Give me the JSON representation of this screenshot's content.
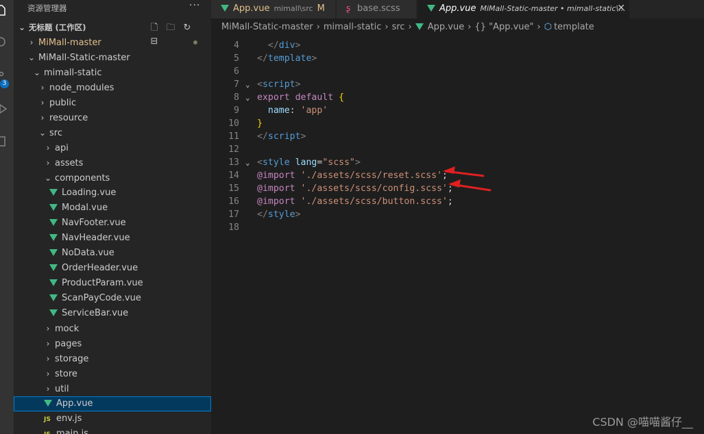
{
  "sidebar": {
    "title": "资源管理器",
    "more": "···",
    "root": "无标题 (工作区)",
    "items": [
      {
        "label": "MiMall-master",
        "kind": "folder-collapsed",
        "depth": 0
      },
      {
        "label": "MiMall-Static-master",
        "kind": "folder-open",
        "depth": 0
      },
      {
        "label": "mimall-static",
        "kind": "folder-open",
        "depth": 1
      },
      {
        "label": "node_modules",
        "kind": "folder-collapsed",
        "depth": 2
      },
      {
        "label": "public",
        "kind": "folder-collapsed",
        "depth": 2
      },
      {
        "label": "resource",
        "kind": "folder-collapsed",
        "depth": 2
      },
      {
        "label": "src",
        "kind": "folder-open",
        "depth": 2
      },
      {
        "label": "api",
        "kind": "folder-collapsed",
        "depth": 3
      },
      {
        "label": "assets",
        "kind": "folder-collapsed",
        "depth": 3
      },
      {
        "label": "components",
        "kind": "folder-open",
        "depth": 3
      },
      {
        "label": "Loading.vue",
        "kind": "vue",
        "depth": 4
      },
      {
        "label": "Modal.vue",
        "kind": "vue",
        "depth": 4
      },
      {
        "label": "NavFooter.vue",
        "kind": "vue",
        "depth": 4
      },
      {
        "label": "NavHeader.vue",
        "kind": "vue",
        "depth": 4
      },
      {
        "label": "NoData.vue",
        "kind": "vue",
        "depth": 4
      },
      {
        "label": "OrderHeader.vue",
        "kind": "vue",
        "depth": 4
      },
      {
        "label": "ProductParam.vue",
        "kind": "vue",
        "depth": 4
      },
      {
        "label": "ScanPayCode.vue",
        "kind": "vue",
        "depth": 4
      },
      {
        "label": "ServiceBar.vue",
        "kind": "vue",
        "depth": 4
      },
      {
        "label": "mock",
        "kind": "folder-collapsed",
        "depth": 3
      },
      {
        "label": "pages",
        "kind": "folder-collapsed",
        "depth": 3
      },
      {
        "label": "storage",
        "kind": "folder-collapsed",
        "depth": 3
      },
      {
        "label": "store",
        "kind": "folder-collapsed",
        "depth": 3
      },
      {
        "label": "util",
        "kind": "folder-collapsed",
        "depth": 3
      },
      {
        "label": "App.vue",
        "kind": "vue",
        "depth": 3,
        "selected": true
      },
      {
        "label": "env.js",
        "kind": "js",
        "depth": 3
      },
      {
        "label": "main.js",
        "kind": "js",
        "depth": 3
      }
    ]
  },
  "activity": {
    "scm_badge": "3"
  },
  "tabs": [
    {
      "label": "App.vue",
      "description": "mimall\\src",
      "modified": "M",
      "icon": "vue-icon",
      "active": false
    },
    {
      "label": "base.scss",
      "description": "",
      "modified": "",
      "icon": "scss-icon",
      "active": false
    },
    {
      "label": "App.vue",
      "description": "MiMall-Static-master • mimall-static\\...",
      "modified": "",
      "icon": "vue-icon",
      "active": true,
      "close": "✕"
    }
  ],
  "breadcrumb": [
    "MiMall-Static-master",
    "mimall-static",
    "src",
    "App.vue",
    "{} \"App.vue\"",
    "template"
  ],
  "editor": {
    "lines": [
      {
        "n": "4",
        "fold": "",
        "tokens": [
          [
            "t-pl",
            "  "
          ],
          [
            "t-tag",
            "</"
          ],
          [
            "t-name",
            "div"
          ],
          [
            "t-tag",
            ">"
          ]
        ]
      },
      {
        "n": "5",
        "fold": "",
        "tokens": [
          [
            "t-tag",
            "</"
          ],
          [
            "t-name",
            "template"
          ],
          [
            "t-tag",
            ">"
          ]
        ]
      },
      {
        "n": "6",
        "fold": "",
        "tokens": []
      },
      {
        "n": "7",
        "fold": "⌄",
        "tokens": [
          [
            "t-tag",
            "<"
          ],
          [
            "t-name",
            "script"
          ],
          [
            "t-tag",
            ">"
          ]
        ]
      },
      {
        "n": "8",
        "fold": "⌄",
        "tokens": [
          [
            "t-kw",
            "export"
          ],
          [
            "t-pl",
            " "
          ],
          [
            "t-kw",
            "default"
          ],
          [
            "t-pl",
            " "
          ],
          [
            "t-br",
            "{"
          ]
        ]
      },
      {
        "n": "9",
        "fold": "",
        "tokens": [
          [
            "t-pl",
            "  "
          ],
          [
            "t-attr",
            "name"
          ],
          [
            "t-pl",
            ": "
          ],
          [
            "t-str",
            "'app'"
          ]
        ]
      },
      {
        "n": "10",
        "fold": "",
        "tokens": [
          [
            "t-br",
            "}"
          ]
        ]
      },
      {
        "n": "11",
        "fold": "",
        "tokens": [
          [
            "t-tag",
            "</"
          ],
          [
            "t-name",
            "script"
          ],
          [
            "t-tag",
            ">"
          ]
        ]
      },
      {
        "n": "12",
        "fold": "",
        "tokens": []
      },
      {
        "n": "13",
        "fold": "⌄",
        "tokens": [
          [
            "t-tag",
            "<"
          ],
          [
            "t-name",
            "style"
          ],
          [
            "t-pl",
            " "
          ],
          [
            "t-attr",
            "lang"
          ],
          [
            "t-pl",
            "="
          ],
          [
            "t-str",
            "\"scss\""
          ],
          [
            "t-tag",
            ">"
          ]
        ]
      },
      {
        "n": "14",
        "fold": "",
        "tokens": [
          [
            "t-at",
            "@import"
          ],
          [
            "t-pl",
            " "
          ],
          [
            "t-str",
            "'./assets/scss/reset.scss'"
          ],
          [
            "t-pl",
            ";"
          ]
        ]
      },
      {
        "n": "15",
        "fold": "",
        "tokens": [
          [
            "t-at",
            "@import"
          ],
          [
            "t-pl",
            " "
          ],
          [
            "t-str",
            "'./assets/scss/config.scss'"
          ],
          [
            "t-pl",
            ";"
          ]
        ]
      },
      {
        "n": "16",
        "fold": "",
        "tokens": [
          [
            "t-at",
            "@import"
          ],
          [
            "t-pl",
            " "
          ],
          [
            "t-str",
            "'./assets/scss/button.scss'"
          ],
          [
            "t-pl",
            ";"
          ]
        ]
      },
      {
        "n": "17",
        "fold": "",
        "tokens": [
          [
            "t-tag",
            "</"
          ],
          [
            "t-name",
            "style"
          ],
          [
            "t-tag",
            ">"
          ]
        ]
      },
      {
        "n": "18",
        "fold": "",
        "tokens": []
      }
    ]
  },
  "watermark": "CSDN @喵喵酱仔__",
  "colors": {
    "accent": "#007fd4",
    "vue": "#41b883",
    "arrow": "#e02020"
  }
}
